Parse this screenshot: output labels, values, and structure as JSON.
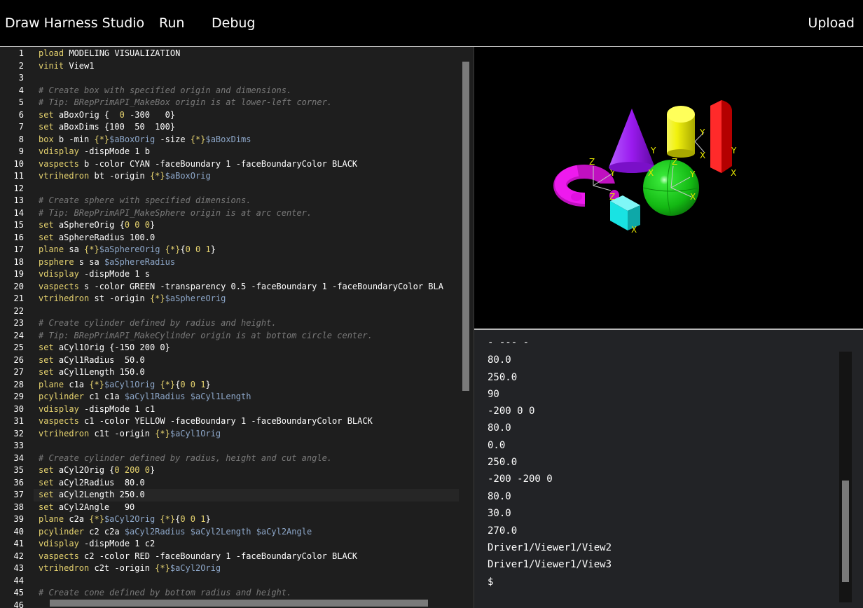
{
  "app": {
    "title": "Draw Harness Studio",
    "menu": [
      "Run",
      "Debug"
    ],
    "upload_label": "Upload"
  },
  "editor": {
    "active_line": 37,
    "lines": [
      {
        "n": "1",
        "t": [
          [
            "kw",
            "pload"
          ],
          [
            "st",
            " MODELING VISUALIZATION"
          ]
        ]
      },
      {
        "n": "2",
        "t": [
          [
            "kw",
            "vinit"
          ],
          [
            "st",
            " View1"
          ]
        ]
      },
      {
        "n": "3",
        "t": []
      },
      {
        "n": "4",
        "t": [
          [
            "cm",
            "# Create box with specified origin and dimensions."
          ]
        ]
      },
      {
        "n": "5",
        "t": [
          [
            "cm",
            "# Tip: BRepPrimAPI_MakeBox origin is at lower-left corner."
          ]
        ]
      },
      {
        "n": "6",
        "t": [
          [
            "kw",
            "set"
          ],
          [
            "st",
            " aBoxOrig {  "
          ],
          [
            "br",
            "0"
          ],
          [
            "st",
            " -300   0}"
          ]
        ]
      },
      {
        "n": "7",
        "t": [
          [
            "kw",
            "set"
          ],
          [
            "st",
            " aBoxDims {100  50  100}"
          ]
        ]
      },
      {
        "n": "8",
        "t": [
          [
            "kw",
            "box"
          ],
          [
            "st",
            " b -min "
          ],
          [
            "br",
            "{*}"
          ],
          [
            "vr",
            "$aBoxOrig"
          ],
          [
            "st",
            " -size "
          ],
          [
            "br",
            "{*}"
          ],
          [
            "vr",
            "$aBoxDims"
          ]
        ]
      },
      {
        "n": "9",
        "t": [
          [
            "kw",
            "vdisplay"
          ],
          [
            "st",
            " -dispMode 1 b"
          ]
        ]
      },
      {
        "n": "10",
        "t": [
          [
            "kw",
            "vaspects"
          ],
          [
            "st",
            " b -color CYAN -faceBoundary 1 -faceBoundaryColor BLACK"
          ]
        ]
      },
      {
        "n": "11",
        "t": [
          [
            "kw",
            "vtrihedron"
          ],
          [
            "st",
            " bt -origin "
          ],
          [
            "br",
            "{*}"
          ],
          [
            "vr",
            "$aBoxOrig"
          ]
        ]
      },
      {
        "n": "12",
        "t": []
      },
      {
        "n": "13",
        "t": [
          [
            "cm",
            "# Create sphere with specified dimensions."
          ]
        ]
      },
      {
        "n": "14",
        "t": [
          [
            "cm",
            "# Tip: BRepPrimAPI_MakeSphere origin is at arc center."
          ]
        ]
      },
      {
        "n": "15",
        "t": [
          [
            "kw",
            "set"
          ],
          [
            "st",
            " aSphereOrig {"
          ],
          [
            "br",
            "0 0 0"
          ],
          [
            "st",
            "}"
          ]
        ]
      },
      {
        "n": "16",
        "t": [
          [
            "kw",
            "set"
          ],
          [
            "st",
            " aSphereRadius 100.0"
          ]
        ]
      },
      {
        "n": "17",
        "t": [
          [
            "kw",
            "plane"
          ],
          [
            "st",
            " sa "
          ],
          [
            "br",
            "{*}"
          ],
          [
            "vr",
            "$aSphereOrig"
          ],
          [
            "st",
            " "
          ],
          [
            "br",
            "{*}"
          ],
          [
            "st",
            "{"
          ],
          [
            "br",
            "0 0 1"
          ],
          [
            "st",
            "}"
          ]
        ]
      },
      {
        "n": "18",
        "t": [
          [
            "kw",
            "psphere"
          ],
          [
            "st",
            " s sa "
          ],
          [
            "vr",
            "$aSphereRadius"
          ]
        ]
      },
      {
        "n": "19",
        "t": [
          [
            "kw",
            "vdisplay"
          ],
          [
            "st",
            " -dispMode 1 s"
          ]
        ]
      },
      {
        "n": "20",
        "t": [
          [
            "kw",
            "vaspects"
          ],
          [
            "st",
            " s -color GREEN -transparency 0.5 -faceBoundary 1 -faceBoundaryColor BLA"
          ]
        ]
      },
      {
        "n": "21",
        "t": [
          [
            "kw",
            "vtrihedron"
          ],
          [
            "st",
            " st -origin "
          ],
          [
            "br",
            "{*}"
          ],
          [
            "vr",
            "$aSphereOrig"
          ]
        ]
      },
      {
        "n": "22",
        "t": []
      },
      {
        "n": "23",
        "t": [
          [
            "cm",
            "# Create cylinder defined by radius and height."
          ]
        ]
      },
      {
        "n": "24",
        "t": [
          [
            "cm",
            "# Tip: BRepPrimAPI_MakeCylinder origin is at bottom circle center."
          ]
        ]
      },
      {
        "n": "25",
        "t": [
          [
            "kw",
            "set"
          ],
          [
            "st",
            " aCyl1Orig {-150 200 0}"
          ]
        ]
      },
      {
        "n": "26",
        "t": [
          [
            "kw",
            "set"
          ],
          [
            "st",
            " aCyl1Radius  50.0"
          ]
        ]
      },
      {
        "n": "27",
        "t": [
          [
            "kw",
            "set"
          ],
          [
            "st",
            " aCyl1Length 150.0"
          ]
        ]
      },
      {
        "n": "28",
        "t": [
          [
            "kw",
            "plane"
          ],
          [
            "st",
            " c1a "
          ],
          [
            "br",
            "{*}"
          ],
          [
            "vr",
            "$aCyl1Orig"
          ],
          [
            "st",
            " "
          ],
          [
            "br",
            "{*}"
          ],
          [
            "st",
            "{"
          ],
          [
            "br",
            "0 0 1"
          ],
          [
            "st",
            "}"
          ]
        ]
      },
      {
        "n": "29",
        "t": [
          [
            "kw",
            "pcylinder"
          ],
          [
            "st",
            " c1 c1a "
          ],
          [
            "vr",
            "$aCyl1Radius"
          ],
          [
            "st",
            " "
          ],
          [
            "vr",
            "$aCyl1Length"
          ]
        ]
      },
      {
        "n": "30",
        "t": [
          [
            "kw",
            "vdisplay"
          ],
          [
            "st",
            " -dispMode 1 c1"
          ]
        ]
      },
      {
        "n": "31",
        "t": [
          [
            "kw",
            "vaspects"
          ],
          [
            "st",
            " c1 -color YELLOW -faceBoundary 1 -faceBoundaryColor BLACK"
          ]
        ]
      },
      {
        "n": "32",
        "t": [
          [
            "kw",
            "vtrihedron"
          ],
          [
            "st",
            " c1t -origin "
          ],
          [
            "br",
            "{*}"
          ],
          [
            "vr",
            "$aCyl1Orig"
          ]
        ]
      },
      {
        "n": "33",
        "t": []
      },
      {
        "n": "34",
        "t": [
          [
            "cm",
            "# Create cylinder defined by radius, height and cut angle."
          ]
        ]
      },
      {
        "n": "35",
        "t": [
          [
            "kw",
            "set"
          ],
          [
            "st",
            " aCyl2Orig {"
          ],
          [
            "br",
            "0 200 0"
          ],
          [
            "st",
            "}"
          ]
        ]
      },
      {
        "n": "36",
        "t": [
          [
            "kw",
            "set"
          ],
          [
            "st",
            " aCyl2Radius  80.0"
          ]
        ]
      },
      {
        "n": "37",
        "t": [
          [
            "kw",
            "set"
          ],
          [
            "st",
            " aCyl2Length 250.0"
          ]
        ]
      },
      {
        "n": "38",
        "t": [
          [
            "kw",
            "set"
          ],
          [
            "st",
            " aCyl2Angle   90"
          ]
        ]
      },
      {
        "n": "39",
        "t": [
          [
            "kw",
            "plane"
          ],
          [
            "st",
            " c2a "
          ],
          [
            "br",
            "{*}"
          ],
          [
            "vr",
            "$aCyl2Orig"
          ],
          [
            "st",
            " "
          ],
          [
            "br",
            "{*}"
          ],
          [
            "st",
            "{"
          ],
          [
            "br",
            "0 0 1"
          ],
          [
            "st",
            "}"
          ]
        ]
      },
      {
        "n": "40",
        "t": [
          [
            "kw",
            "pcylinder"
          ],
          [
            "st",
            " c2 c2a "
          ],
          [
            "vr",
            "$aCyl2Radius"
          ],
          [
            "st",
            " "
          ],
          [
            "vr",
            "$aCyl2Length"
          ],
          [
            "st",
            " "
          ],
          [
            "vr",
            "$aCyl2Angle"
          ]
        ]
      },
      {
        "n": "41",
        "t": [
          [
            "kw",
            "vdisplay"
          ],
          [
            "st",
            " -dispMode 1 c2"
          ]
        ]
      },
      {
        "n": "42",
        "t": [
          [
            "kw",
            "vaspects"
          ],
          [
            "st",
            " c2 -color RED -faceBoundary 1 -faceBoundaryColor BLACK"
          ]
        ]
      },
      {
        "n": "43",
        "t": [
          [
            "kw",
            "vtrihedron"
          ],
          [
            "st",
            " c2t -origin "
          ],
          [
            "br",
            "{*}"
          ],
          [
            "vr",
            "$aCyl2Orig"
          ]
        ]
      },
      {
        "n": "44",
        "t": []
      },
      {
        "n": "45",
        "t": [
          [
            "cm",
            "# Create cone defined by bottom radius and height."
          ]
        ]
      },
      {
        "n": "46",
        "t": []
      }
    ]
  },
  "viewer": {
    "axis_labels": [
      "X",
      "Y",
      "Z"
    ],
    "colors": {
      "box": "#19e3e3",
      "sphere": "#19d419",
      "cylinder1": "#f2f20e",
      "cylinder2": "#ee0000",
      "torus": "#ee1aee",
      "cone": "#9a1aee",
      "axis": "#e6e600"
    }
  },
  "console": {
    "lines": [
      "- --- -",
      "80.0",
      "250.0",
      "90",
      "-200 0 0",
      "80.0",
      "0.0",
      "250.0",
      "-200 -200 0",
      "80.0",
      "30.0",
      "270.0",
      "Driver1/Viewer1/View2",
      "Driver1/Viewer1/View3",
      "$"
    ]
  }
}
